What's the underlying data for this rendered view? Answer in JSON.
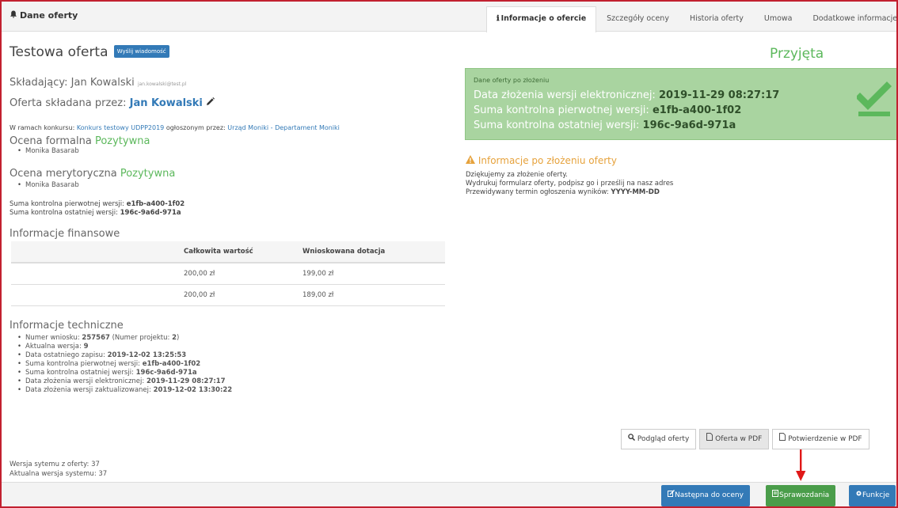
{
  "topbar": {
    "title": "Dane oferty",
    "tabs": [
      {
        "label": "Informacje o ofercie",
        "active": true
      },
      {
        "label": "Szczegóły oceny"
      },
      {
        "label": "Historia oferty"
      },
      {
        "label": "Umowa"
      },
      {
        "label": "Dodatkowe informacje"
      }
    ]
  },
  "offer": {
    "title": "Testowa oferta",
    "message_button": "Wyślij wiadomość",
    "status": "Przyjęta",
    "submitter_label": "Składający:",
    "submitter_name": "Jan Kowalski",
    "submitter_email": "jan.kowalski@test.pl",
    "submitted_by_label": "Oferta składana przez:",
    "submitted_by_name": "Jan Kowalski",
    "contest_prefix": "W ramach konkursu:",
    "contest_name": "Konkurs testowy UDPP2019",
    "contest_mid": "ogłoszonym przez:",
    "contest_org": "Urząd Moniki - Departament Moniki",
    "formal_label": "Ocena formalna",
    "formal_value": "Pozytywna",
    "formal_evaluator": "Monika Basarab",
    "merit_label": "Ocena merytoryczna",
    "merit_value": "Pozytywna",
    "merit_evaluator": "Monika Basarab",
    "checksum_original_label": "Suma kontrolna pierwotnej wersji:",
    "checksum_original": "e1fb-a400-1f02",
    "checksum_last_label": "Suma kontrolna ostatniej wersji:",
    "checksum_last": "196c-9a6d-971a"
  },
  "finance": {
    "title": "Informacje finansowe",
    "headers": [
      "",
      "Całkowita wartość",
      "Wnioskowana dotacja"
    ],
    "rows": [
      [
        "",
        "200,00 zł",
        "199,00 zł"
      ],
      [
        "",
        "200,00 zł",
        "189,00 zł"
      ]
    ]
  },
  "tech": {
    "title": "Informacje techniczne",
    "app_no_label": "Numer wniosku:",
    "app_no": "257567",
    "project_no_open": "(Numer projektu:",
    "project_no": "2",
    "project_no_close": ")",
    "version_label": "Aktualna wersja:",
    "version": "9",
    "last_save_label": "Data ostatniego zapisu:",
    "last_save": "2019-12-02 13:25:53",
    "cs_orig_label": "Suma kontrolna pierwotnej wersji:",
    "cs_orig": "e1fb-a400-1f02",
    "cs_last_label": "Suma kontrolna ostatniej wersji:",
    "cs_last": "196c-9a6d-971a",
    "e_date_label": "Data złożenia wersji elektronicznej:",
    "e_date": "2019-11-29 08:27:17",
    "upd_date_label": "Data złożenia wersji zaktualizowanej:",
    "upd_date": "2019-12-02 13:30:22"
  },
  "system": {
    "offer_version": "Wersja sytemu z oferty: 37",
    "current_version": "Aktualna wersja systemu: 37"
  },
  "submission_box": {
    "heading": "Dane oferty po złożeniu",
    "e_date_label": "Data złożenia wersji elektronicznej:",
    "e_date": "2019-11-29 08:27:17",
    "cs_orig_label": "Suma kontrolna pierwotnej wersji:",
    "cs_orig": "e1fb-a400-1f02",
    "cs_last_label": "Suma kontrolna ostatniej wersji:",
    "cs_last": "196c-9a6d-971a"
  },
  "post_info": {
    "title": "Informacje po złożeniu oferty",
    "line1": "Dziękujemy za złożenie oferty.",
    "line2": "Wydrukuj formularz oferty, podpisz go i prześlij na nasz adres",
    "line3_label": "Przewidywany termin ogłoszenia wyników:",
    "line3_value": "YYYY-MM-DD"
  },
  "buttons": {
    "preview": "Podgląd oferty",
    "pdf": "Oferta w PDF",
    "confirm_pdf": "Potwierdzenie w PDF"
  },
  "bottom": {
    "next": "Następna do oceny",
    "reports": "Sprawozdania",
    "functions": "Funkcje"
  },
  "colors": {
    "accent": "#337ab7",
    "success": "#5cb85c",
    "success_box": "#a9d4a0",
    "warning": "#e6a23c",
    "border_highlight": "#c2202f",
    "arrow": "#e01818"
  }
}
